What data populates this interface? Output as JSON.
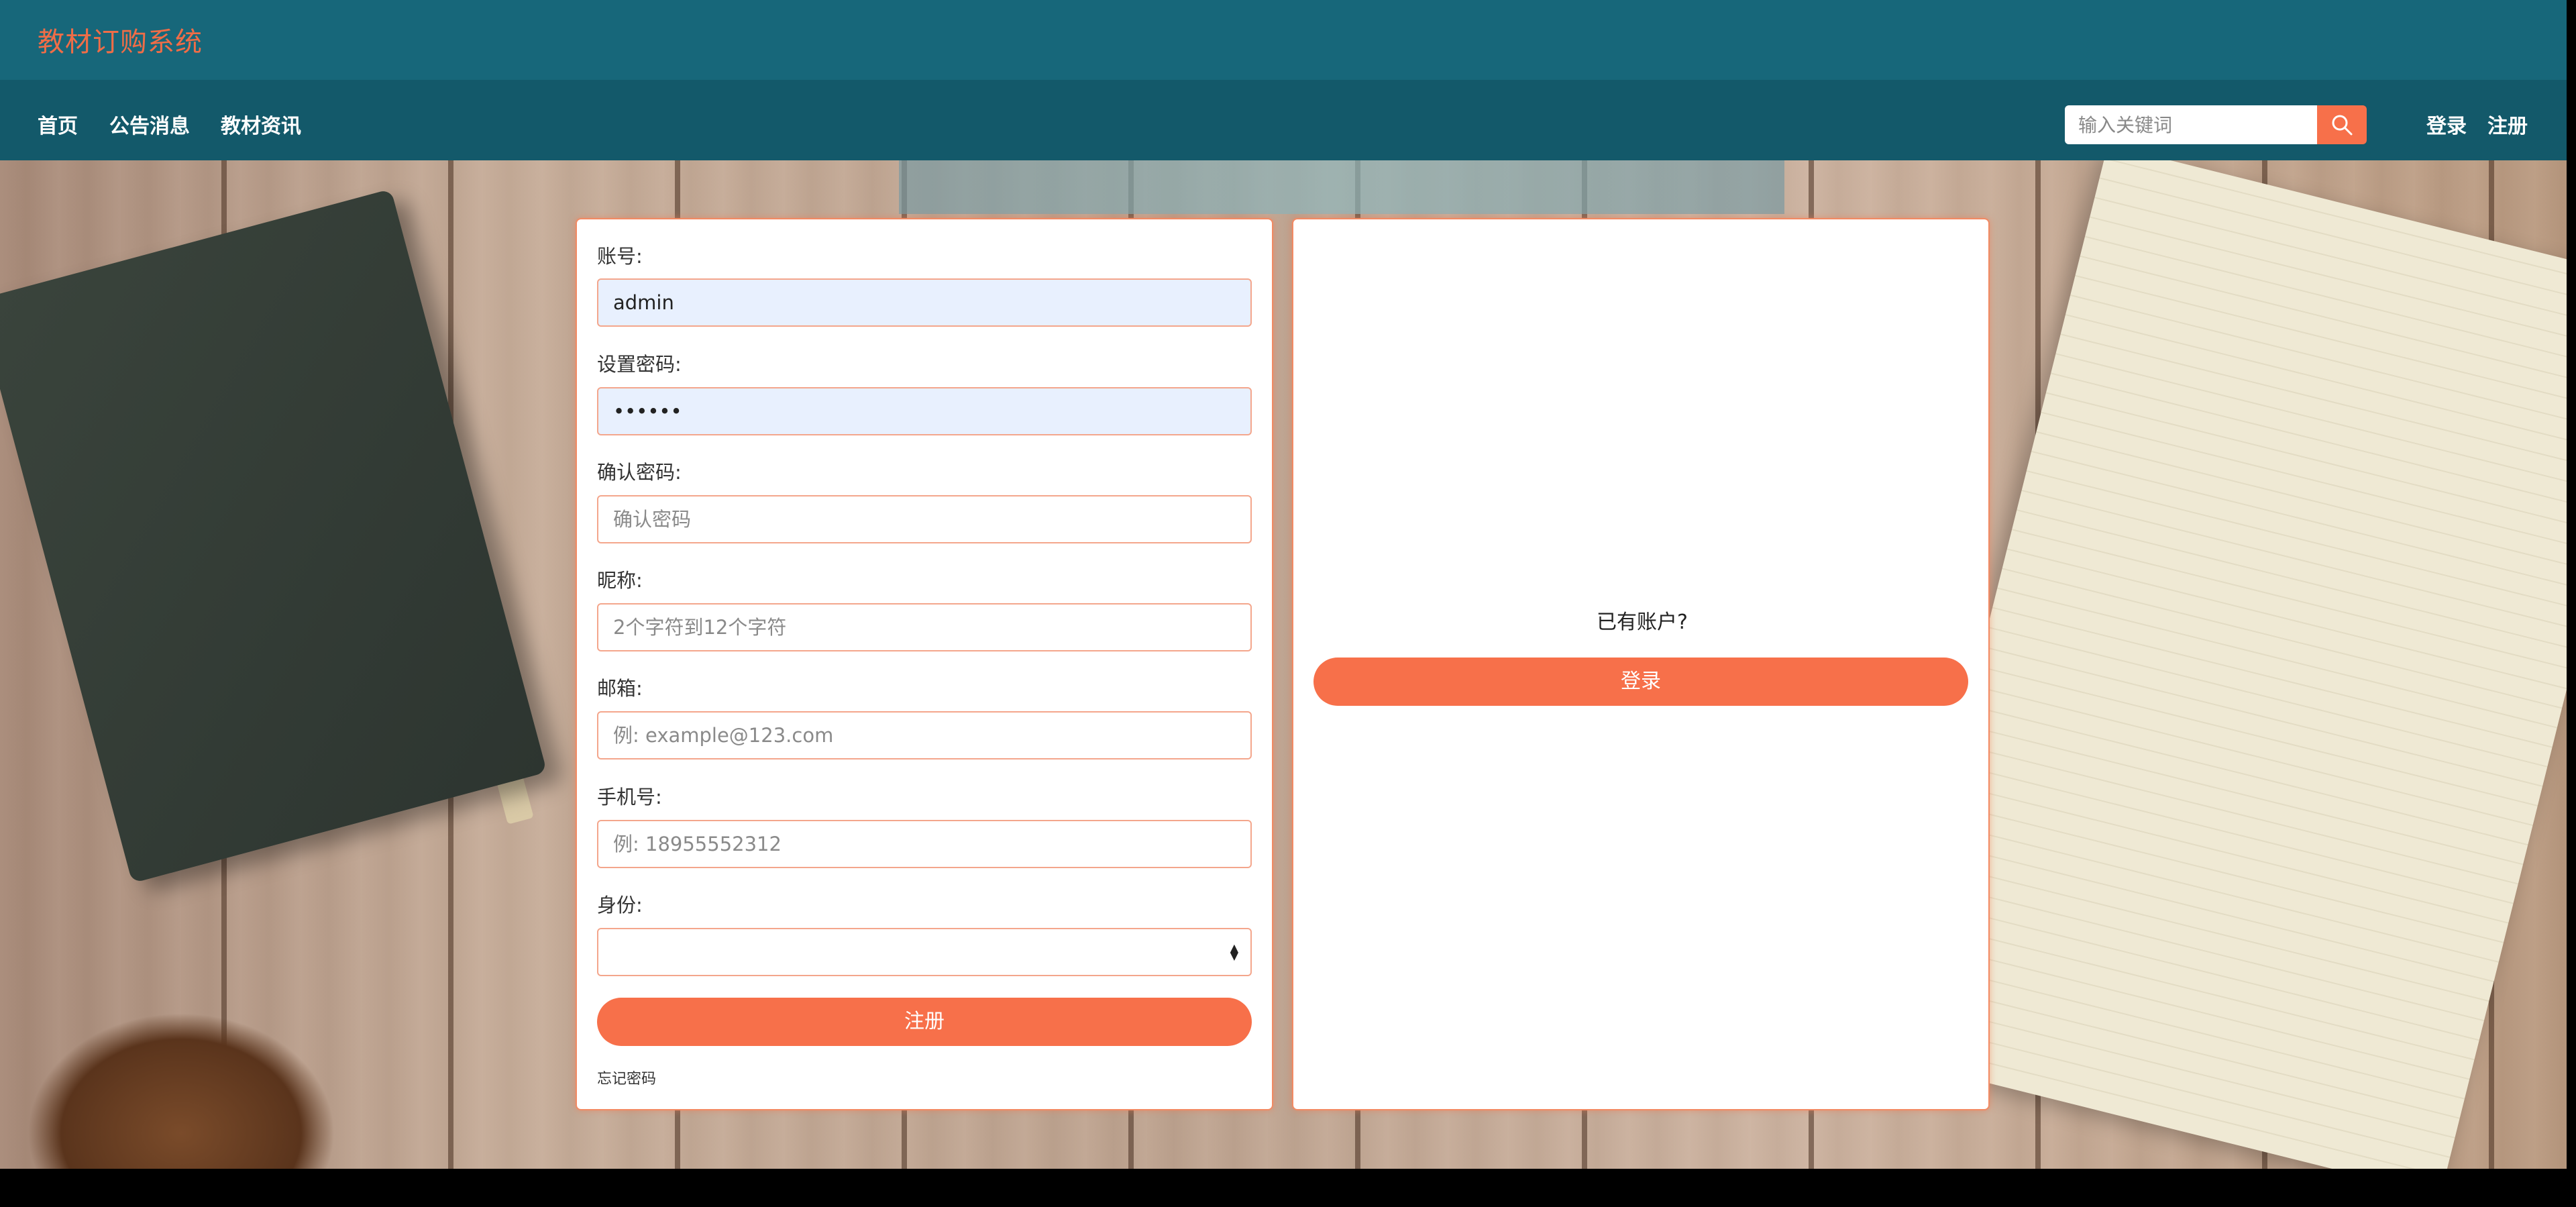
{
  "header": {
    "app_title": "教材订购系统"
  },
  "nav": {
    "items": [
      "首页",
      "公告消息",
      "教材资讯"
    ],
    "search_placeholder": "输入关键词",
    "login_label": "登录",
    "register_label": "注册"
  },
  "register_form": {
    "account_label": "账号:",
    "account_value": "admin",
    "password_label": "设置密码:",
    "password_value": "123456",
    "confirm_label": "确认密码:",
    "confirm_placeholder": "确认密码",
    "nickname_label": "昵称:",
    "nickname_placeholder": "2个字符到12个字符",
    "email_label": "邮箱:",
    "email_placeholder": "例: example@123.com",
    "phone_label": "手机号:",
    "phone_placeholder": "例: 18955552312",
    "role_label": "身份:",
    "role_value": "",
    "submit_label": "注册",
    "forgot_label": "忘记密码"
  },
  "login_panel": {
    "prompt": "已有账户?",
    "login_button": "登录"
  },
  "colors": {
    "topbar": "#17677a",
    "navbar": "#13596a",
    "accent": "#f7704a",
    "input_border": "#f4a68c"
  }
}
